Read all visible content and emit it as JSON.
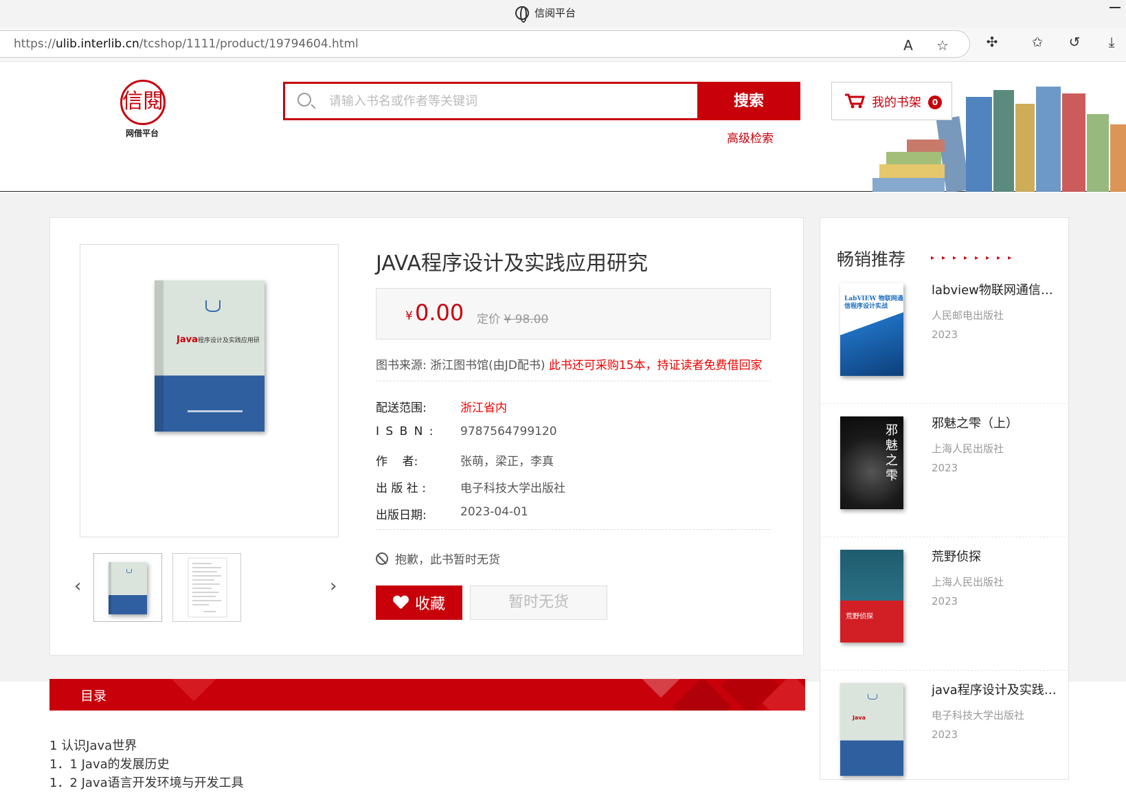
{
  "browser": {
    "tab_title": "信阅平台",
    "url_prefix": "https://",
    "url_host": "ulib.interlib.cn",
    "url_path": "/tcshop/1111/product/19794604.html"
  },
  "header": {
    "logo_text": "信閱",
    "logo_sub": "网借平台",
    "search_placeholder": "请输入书名或作者等关键词",
    "search_button": "搜索",
    "advanced_search": "高级检索",
    "shelf_label": "我的书架",
    "shelf_count": "0"
  },
  "product": {
    "title": "JAVA程序设计及实践应用研究",
    "currency": "¥",
    "price": "0.00",
    "list_price_label": "定价",
    "list_price": "¥ 98.00",
    "source_label": "图书来源: 浙江图书馆(由JD配书)",
    "source_note": "此书还可采购15本，持证读者免费借回家",
    "fields": [
      {
        "label": "配送范围:",
        "value": "浙江省内",
        "highlight": true
      },
      {
        "label": "I S B N :",
        "value": "9787564799120",
        "highlight": false
      },
      {
        "label": "作    者:",
        "value": "张萌，梁正，李真",
        "highlight": false
      },
      {
        "label": "出 版 社 :",
        "value": "电子科技大学出版社",
        "highlight": false
      },
      {
        "label": "出版日期:",
        "value": "2023-04-01",
        "highlight": false
      }
    ],
    "stock_text": "抱歉，此书暂时无货",
    "favorite_button": "收藏",
    "unavailable_button": "暂时无货",
    "cover_java": "Java",
    "cover_title": "程序设计及实践应用研究"
  },
  "sidebar": {
    "title": "畅销推荐",
    "dots": "▸▸▸▸▸▸▸▸",
    "items": [
      {
        "title": "labview物联网通信程...",
        "publisher": "人民邮电出版社",
        "year": "2023",
        "cover_text": "LabVIEW 物联网通信程序设计实战"
      },
      {
        "title": "邪魅之雫（上）",
        "publisher": "上海人民出版社",
        "year": "2023",
        "cover_text": "邪魅之雫"
      },
      {
        "title": "荒野侦探",
        "publisher": "上海人民出版社",
        "year": "2023",
        "cover_text": "荒野侦探"
      },
      {
        "title": "java程序设计及实践应...",
        "publisher": "电子科技大学出版社",
        "year": "2023",
        "cover_text": ""
      }
    ]
  },
  "toc": {
    "label": "目录",
    "lines": [
      "1 认识Java世界",
      "1．1 Java的发展历史",
      "1．2 Java语言开发环境与开发工具"
    ]
  }
}
